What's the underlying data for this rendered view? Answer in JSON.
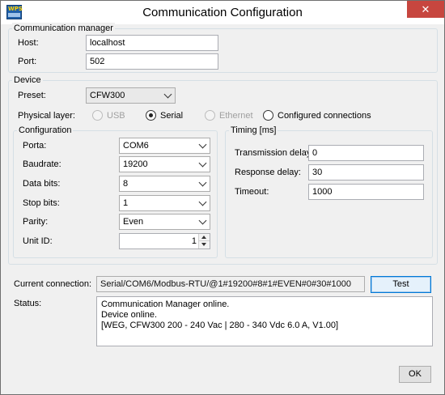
{
  "window": {
    "title": "Communication Configuration",
    "close_glyph": "✕",
    "app_icon_text": "WPS"
  },
  "comm_manager": {
    "group_title": "Communication manager",
    "host_label": "Host:",
    "host_value": "localhost",
    "port_label": "Port:",
    "port_value": "502"
  },
  "device": {
    "group_title": "Device",
    "preset_label": "Preset:",
    "preset_value": "CFW300",
    "physical_layer_label": "Physical layer:",
    "physical_layer_options": [
      {
        "label": "USB",
        "checked": false,
        "enabled": false
      },
      {
        "label": "Serial",
        "checked": true,
        "enabled": true
      },
      {
        "label": "Ethernet",
        "checked": false,
        "enabled": false
      },
      {
        "label": "Configured connections",
        "checked": false,
        "enabled": true
      }
    ]
  },
  "configuration": {
    "group_title": "Configuration",
    "porta_label": "Porta:",
    "porta_value": "COM6",
    "baudrate_label": "Baudrate:",
    "baudrate_value": "19200",
    "databits_label": "Data bits:",
    "databits_value": "8",
    "stopbits_label": "Stop bits:",
    "stopbits_value": "1",
    "parity_label": "Parity:",
    "parity_value": "Even",
    "unitid_label": "Unit ID:",
    "unitid_value": "1"
  },
  "timing": {
    "group_title": "Timing [ms]",
    "tx_delay_label": "Transmission delay:",
    "tx_delay_value": "0",
    "resp_delay_label": "Response delay:",
    "resp_delay_value": "30",
    "timeout_label": "Timeout:",
    "timeout_value": "1000"
  },
  "connection": {
    "current_label": "Current connection:",
    "current_value": "Serial/COM6/Modbus-RTU/@1#19200#8#1#EVEN#0#30#1000",
    "test_label": "Test"
  },
  "status": {
    "label": "Status:",
    "lines": [
      "Communication Manager online.",
      "Device online.",
      "[WEG, CFW300 200 - 240 Vac | 280 - 340 Vdc 6.0 A, V1.00]"
    ]
  },
  "footer": {
    "ok_label": "OK"
  }
}
